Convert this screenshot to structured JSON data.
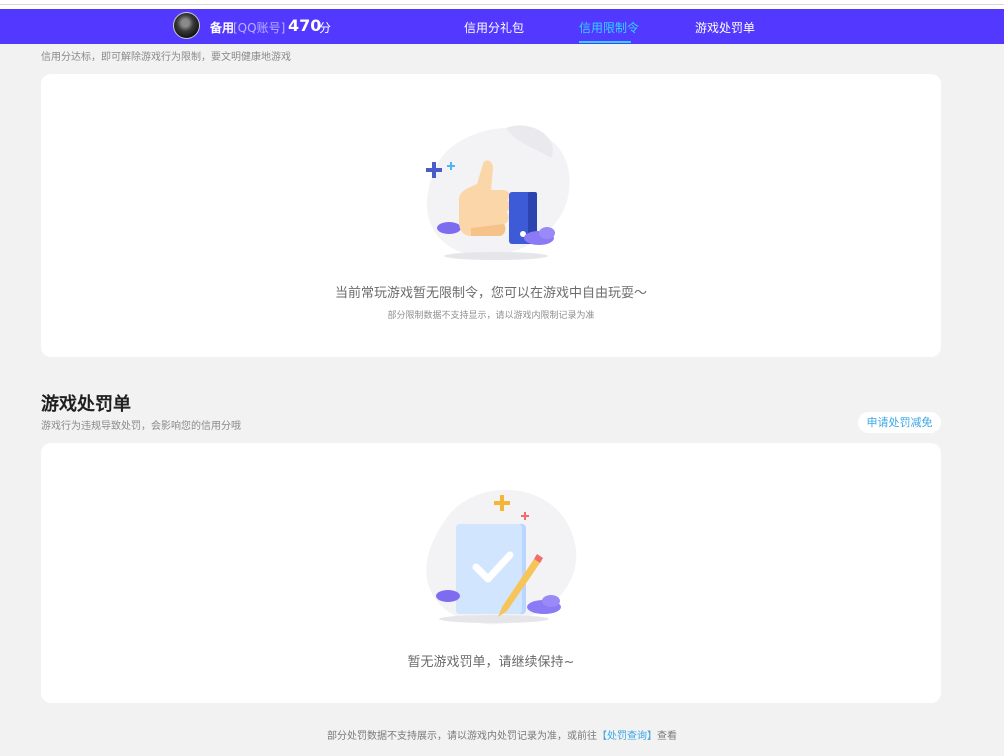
{
  "header": {
    "name": "备用",
    "account": "[QQ账号]",
    "score": "470",
    "score_unit": "分",
    "tabs": [
      {
        "label": "信用分礼包"
      },
      {
        "label": "信用限制令"
      },
      {
        "label": "游戏处罚单"
      }
    ],
    "active_tab": "信用限制令"
  },
  "restriction": {
    "subtitle": "信用分达标，即可解除游戏行为限制，要文明健康地游戏",
    "empty_message": "当前常玩游戏暂无限制令，您可以在游戏中自由玩耍～",
    "note": "部分限制数据不支持显示，请以游戏内限制记录为准"
  },
  "penalty": {
    "title": "游戏处罚单",
    "subtitle": "游戏行为违规导致处罚，会影响您的信用分哦",
    "apply_button": "申请处罚减免",
    "empty_message": "暂无游戏罚单，请继续保持~"
  },
  "footer": {
    "text_before": "部分处罚数据不支持展示，请以游戏内处罚记录为准，或前往",
    "link": "【处罚查询】",
    "text_after": "查看"
  },
  "colors": {
    "nav_bg": "#5338ff",
    "accent": "#30d5ff",
    "link": "#3aa7e6",
    "page_bg": "#f2f2f2"
  }
}
